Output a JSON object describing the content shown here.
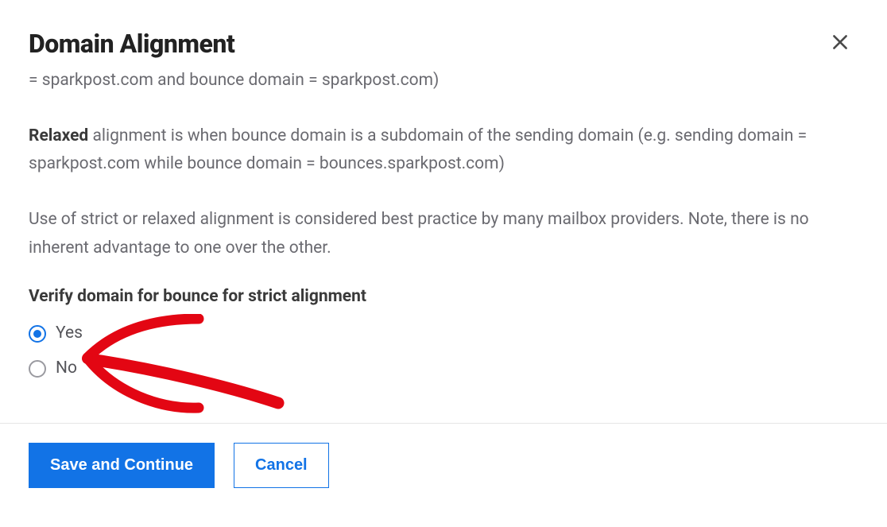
{
  "dialog": {
    "title": "Domain Alignment",
    "paragraph1": "= sparkpost.com and bounce domain = sparkpost.com)",
    "paragraph2_strong": "Relaxed",
    "paragraph2_rest": " alignment is when bounce domain is a subdomain of the sending domain (e.g. sending domain = sparkpost.com while bounce domain = bounces.sparkpost.com)",
    "paragraph3": "Use of strict or relaxed alignment is considered best practice by many mailbox providers. Note, there is no inherent advantage to one over the other.",
    "question": "Verify domain for bounce for strict alignment",
    "options": {
      "yes": "Yes",
      "no": "No"
    },
    "selected": "yes",
    "buttons": {
      "save": "Save and Continue",
      "cancel": "Cancel"
    }
  },
  "colors": {
    "primary": "#1273e6",
    "annotation": "#e30613"
  }
}
